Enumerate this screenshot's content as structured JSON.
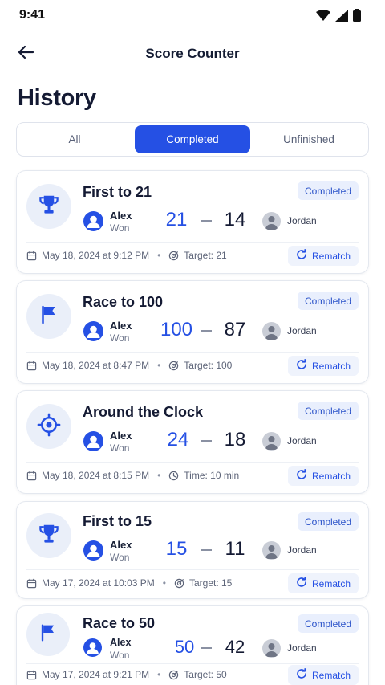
{
  "status_bar": {
    "time": "9:41",
    "icons": [
      "wifi-icon",
      "signal-icon",
      "battery-icon"
    ]
  },
  "header": {
    "title": "Score Counter",
    "back_icon": "arrow-left-icon"
  },
  "page": {
    "heading": "History"
  },
  "tabs": [
    {
      "label": "All",
      "active": false
    },
    {
      "label": "Completed",
      "active": true
    },
    {
      "label": "Unfinished",
      "active": false
    }
  ],
  "colors": {
    "accent": "#2550e4",
    "badge_bg": "#e9effd",
    "icon_bg": "#eaeff9",
    "text_dark": "#141a33",
    "muted": "#5d6478"
  },
  "games": [
    {
      "icon": "trophy-icon",
      "title": "First to 21",
      "status": "Completed",
      "winner": "Alex",
      "winner_status": "Won",
      "score_winner": "21",
      "score_opponent": "14",
      "opponent": "Jordan",
      "date": "May 18, 2024 at 9:12 PM",
      "detail_icon": "target-icon",
      "detail": "Target: 21",
      "action": "Rematch"
    },
    {
      "icon": "flag-icon",
      "title": "Race to 100",
      "status": "Completed",
      "winner": "Alex",
      "winner_status": "Won",
      "score_winner": "100",
      "score_opponent": "87",
      "opponent": "Jordan",
      "date": "May 18, 2024 at 8:47 PM",
      "detail_icon": "target-icon",
      "detail": "Target: 100",
      "action": "Rematch"
    },
    {
      "icon": "crosshair-icon",
      "title": "Around the Clock",
      "status": "Completed",
      "winner": "Alex",
      "winner_status": "Won",
      "score_winner": "24",
      "score_opponent": "18",
      "opponent": "Jordan",
      "date": "May 18, 2024 at 8:15 PM",
      "detail_icon": "clock-icon",
      "detail": "Time: 10 min",
      "action": "Rematch"
    },
    {
      "icon": "trophy-icon",
      "title": "First to 15",
      "status": "Completed",
      "winner": "Alex",
      "winner_status": "Won",
      "score_winner": "15",
      "score_opponent": "11",
      "opponent": "Jordan",
      "date": "May 17, 2024 at 10:03 PM",
      "detail_icon": "target-icon",
      "detail": "Target: 15",
      "action": "Rematch"
    },
    {
      "icon": "flag-icon",
      "title": "Race to 50",
      "status": "Completed",
      "winner": "Alex",
      "winner_status": "Won",
      "score_winner": "50",
      "score_opponent": "42",
      "opponent": "Jordan",
      "date": "May 17, 2024 at 9:21 PM",
      "detail_icon": "target-icon",
      "detail": "Target: 50",
      "action": "Rematch"
    }
  ]
}
